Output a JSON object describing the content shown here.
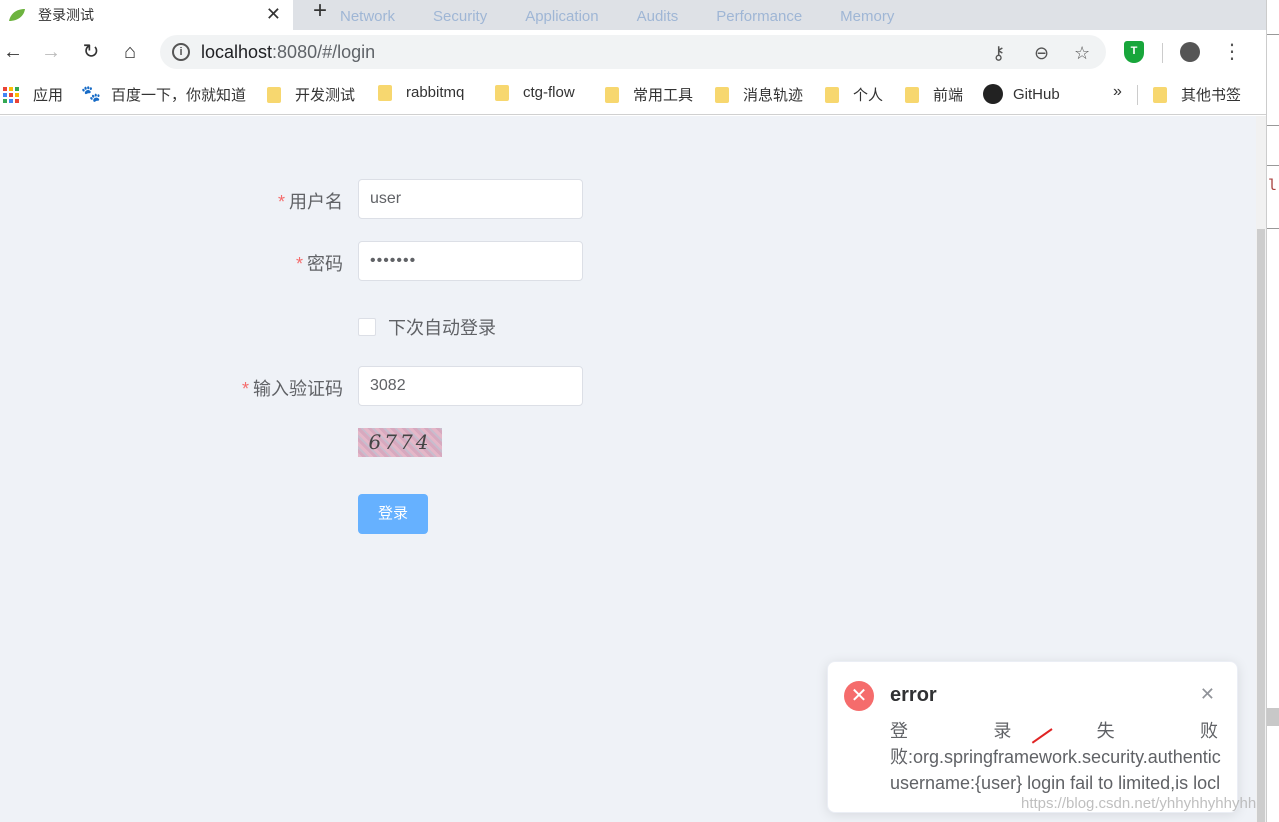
{
  "browser": {
    "tab_title": "登录测试",
    "tab_close": "✕",
    "new_tab": "+",
    "devtools_tabs": [
      "Network",
      "Security",
      "Application",
      "Audits",
      "Performance",
      "Memory"
    ],
    "url_host": "localhost",
    "url_rest": ":8080/#/login",
    "icons": {
      "back": "←",
      "forward": "→",
      "reload": "↻",
      "home": "⌂",
      "key": "⚷",
      "zoom": "⊖",
      "star": "☆",
      "menu": "⋮"
    }
  },
  "bookmarks": [
    {
      "label": "应用",
      "type": "apps"
    },
    {
      "label": "百度一下，你就知道",
      "type": "baidu"
    },
    {
      "label": "开发测试",
      "type": "folder"
    },
    {
      "label": "rabbitmq",
      "type": "folder"
    },
    {
      "label": "ctg-flow",
      "type": "folder"
    },
    {
      "label": "常用工具",
      "type": "folder"
    },
    {
      "label": "消息轨迹",
      "type": "folder"
    },
    {
      "label": "个人",
      "type": "folder"
    },
    {
      "label": "前端",
      "type": "folder"
    },
    {
      "label": "GitHub",
      "type": "github"
    },
    {
      "label": "其他书签",
      "type": "folder"
    }
  ],
  "bookmarks_more": "»",
  "form": {
    "required_mark": "*",
    "username_label": "用户名",
    "username_value": "user",
    "password_label": "密码",
    "password_value": "•••••••",
    "remember_label": "下次自动登录",
    "captcha_label": "输入验证码",
    "captcha_value": "3082",
    "captcha_image_text": "6774",
    "login_button": "登录"
  },
  "notification": {
    "title": "error",
    "close": "✕",
    "icon": "✕",
    "line1_chars": [
      "登",
      "录",
      "失",
      "败"
    ],
    "line2": "败:org.springframework.security.authentic",
    "line3": "username:{user} login fail to limited,is locl"
  },
  "devtools_code": "l:",
  "watermark": "https://blog.csdn.net/yhhyhhyhhyhh",
  "colors": {
    "page_bg": "#eff2f7",
    "required": "#f56c6c",
    "primary_light": "#66b1ff",
    "error": "#f56c6c"
  }
}
